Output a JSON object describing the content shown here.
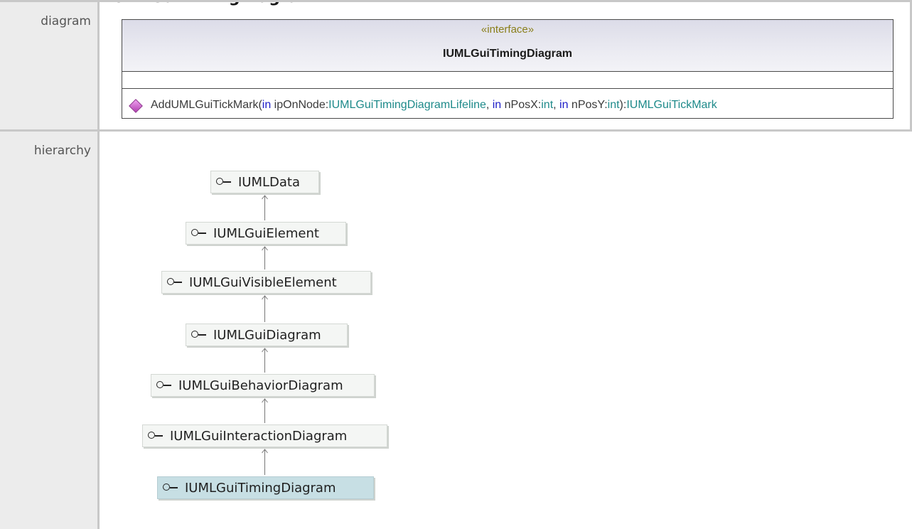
{
  "page": {
    "title": "IUMLGuiTimingDiagram"
  },
  "rows": {
    "diagram_label": "diagram",
    "hierarchy_label": "hierarchy"
  },
  "uml_class": {
    "stereotype": "«interface»",
    "name": "IUMLGuiTimingDiagram",
    "operation": {
      "name": "AddUMLGuiTickMark(",
      "kw1": "in",
      "p1_name": " ipOnNode:",
      "p1_type": "IUMLGuiTimingDiagramLifeline",
      "sep1": ", ",
      "kw2": "in",
      "p2_name": " nPosX:",
      "p2_type": "int",
      "sep2": ", ",
      "kw3": "in",
      "p3_name": " nPosY:",
      "p3_type": "int",
      "close": "):",
      "return_type": "IUMLGuiTickMark"
    }
  },
  "hierarchy": [
    {
      "name": "IUMLData",
      "current": false
    },
    {
      "name": "IUMLGuiElement",
      "current": false
    },
    {
      "name": "IUMLGuiVisibleElement",
      "current": false
    },
    {
      "name": "IUMLGuiDiagram",
      "current": false
    },
    {
      "name": "IUMLGuiBehaviorDiagram",
      "current": false
    },
    {
      "name": "IUMLGuiInteractionDiagram",
      "current": false
    },
    {
      "name": "IUMLGuiTimingDiagram",
      "current": true
    }
  ],
  "icons": {
    "interface": "lollipop-interface-icon",
    "operation": "diamond-operation-icon"
  }
}
